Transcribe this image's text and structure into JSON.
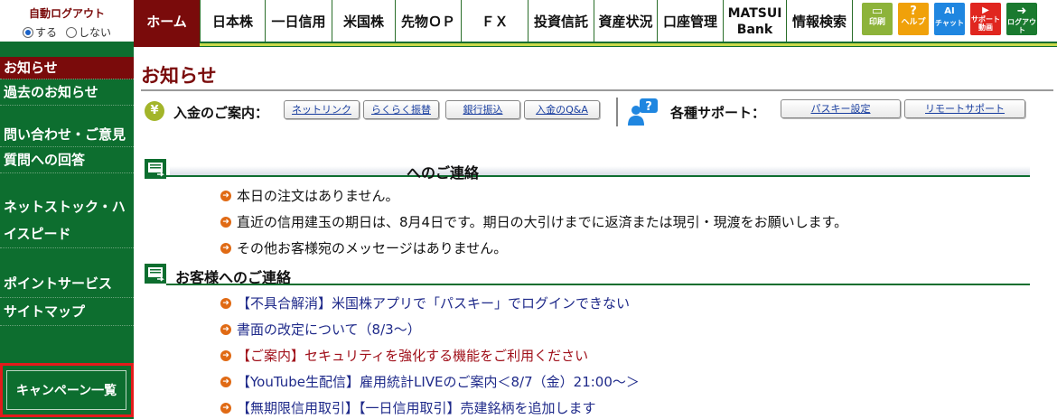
{
  "autologout": {
    "title": "自動ログアウト",
    "on_label": "する",
    "off_label": "しない",
    "selected": "on"
  },
  "nav": [
    {
      "label": "ホーム",
      "active": true,
      "width": 73
    },
    {
      "label": "日本株",
      "width": 72
    },
    {
      "label": "一日信用",
      "width": 74
    },
    {
      "label": "米国株",
      "width": 70
    },
    {
      "label": "先物ＯＰ",
      "width": 73
    },
    {
      "label": "ＦＸ",
      "width": 74
    },
    {
      "label": "投資信託",
      "width": 73
    },
    {
      "label": "資産状況",
      "width": 70
    },
    {
      "label": "口座管理",
      "width": 73
    },
    {
      "label": "MATSUI Bank",
      "width": 70
    },
    {
      "label": "情報検索",
      "width": 74
    }
  ],
  "icon_buttons": [
    {
      "name": "print",
      "glyph": "▭",
      "label": "印刷",
      "color": "#8db33a"
    },
    {
      "name": "help",
      "glyph": "?",
      "label": "ヘルプ",
      "color": "#f0a10a"
    },
    {
      "name": "ai-chat",
      "glyph": "AI",
      "label": "チャット",
      "color": "#1f86e0"
    },
    {
      "name": "support-video",
      "glyph": "▶",
      "label": "サポート動画",
      "color": "#e0261f"
    },
    {
      "name": "logout",
      "glyph": "➜",
      "label": "ログアウト",
      "color": "#1a7a2f"
    }
  ],
  "sidebar": {
    "items": [
      {
        "label": "お知らせ",
        "active": true
      },
      {
        "label": "過去のお知らせ"
      },
      {
        "label": "問い合わせ・ご意見"
      },
      {
        "label": "質問への回答"
      },
      {
        "label": "ネットストック・ハイスピード"
      },
      {
        "label": "ポイントサービス"
      },
      {
        "label": "サイトマップ"
      }
    ],
    "campaign": "キャンペーン一覧"
  },
  "main": {
    "title": "お知らせ",
    "deposit": {
      "label": "入金のご案内：",
      "buttons": [
        "ネットリンク",
        "らくらく振替",
        "銀行振込",
        "入金のQ&A"
      ]
    },
    "support": {
      "label": "各種サポート：",
      "buttons": [
        "パスキー設定",
        "リモートサポート"
      ]
    },
    "section1": {
      "title": "へのご連絡",
      "items": [
        {
          "text": "本日の注文はありません。"
        },
        {
          "text": "直近の信用建玉の期日は、8月4日です。期日の大引けまでに返済または現引・現渡をお願いします。"
        },
        {
          "text": "その他お客様宛のメッセージはありません。"
        }
      ]
    },
    "section2": {
      "title": "お客様へのご連絡",
      "items": [
        {
          "text": "【不具合解消】米国株アプリで「パスキー」でログインできない",
          "style": "link"
        },
        {
          "text": "書面の改定について（8/3〜）",
          "style": "link"
        },
        {
          "text": "【ご案内】セキュリティを強化する機能をご利用ください",
          "style": "red"
        },
        {
          "text": "【YouTube生配信】雇用統計LIVEのご案内＜8/7（金）21:00〜＞",
          "style": "link"
        },
        {
          "text": "【無期限信用取引】【一日信用取引】売建銘柄を追加します",
          "style": "link"
        }
      ]
    }
  }
}
